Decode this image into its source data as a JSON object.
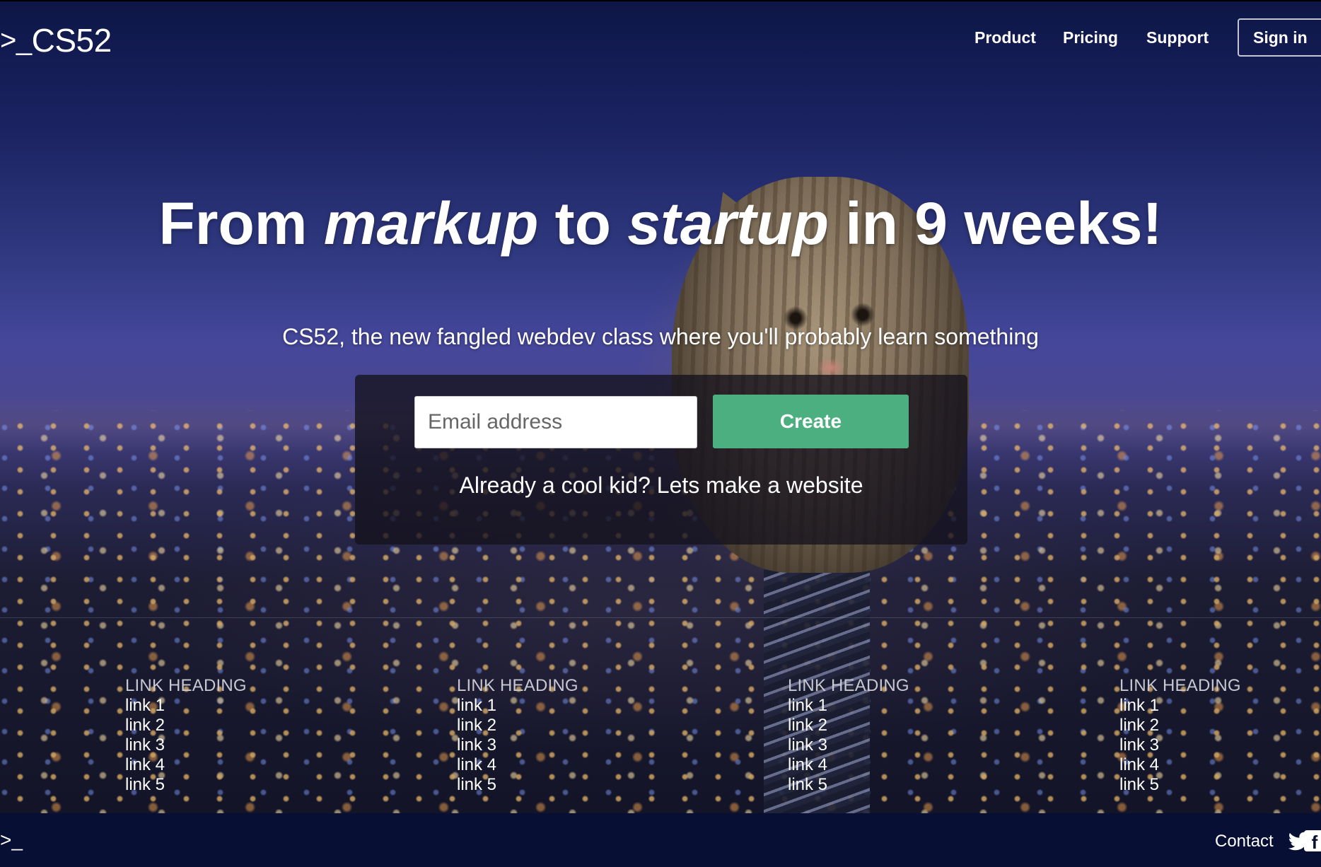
{
  "brand": {
    "logo_prompt": ">_",
    "logo_text": "CS52"
  },
  "nav": {
    "product": "Product",
    "pricing": "Pricing",
    "support": "Support",
    "signin": "Sign in"
  },
  "hero": {
    "headline_part1": "From ",
    "headline_em1": "markup",
    "headline_part2": " to ",
    "headline_em2": "startup",
    "headline_part3": " in 9 weeks!",
    "subtitle": "CS52, the new fangled webdev class where you'll probably learn something"
  },
  "signup": {
    "email_placeholder": "Email address",
    "email_value": "",
    "create_label": "Create",
    "already_text": "Already a cool kid? Lets make a website"
  },
  "link_columns": [
    {
      "heading": "LINK HEADING",
      "links": [
        "link 1",
        "link 2",
        "link 3",
        "link 4",
        "link 5"
      ]
    },
    {
      "heading": "LINK HEADING",
      "links": [
        "link 1",
        "link 2",
        "link 3",
        "link 4",
        "link 5"
      ]
    },
    {
      "heading": "LINK HEADING",
      "links": [
        "link 1",
        "link 2",
        "link 3",
        "link 4",
        "link 5"
      ]
    },
    {
      "heading": "LINK HEADING",
      "links": [
        "link 1",
        "link 2",
        "link 3",
        "link 4",
        "link 5"
      ]
    }
  ],
  "footer": {
    "logo_prompt": ">_",
    "contact": "Contact",
    "icons": [
      "twitter-icon",
      "facebook-icon"
    ]
  },
  "colors": {
    "accent_green": "#4caf7f",
    "footer_bg": "#071034",
    "panel_bg": "rgba(20,18,28,0.78)"
  }
}
